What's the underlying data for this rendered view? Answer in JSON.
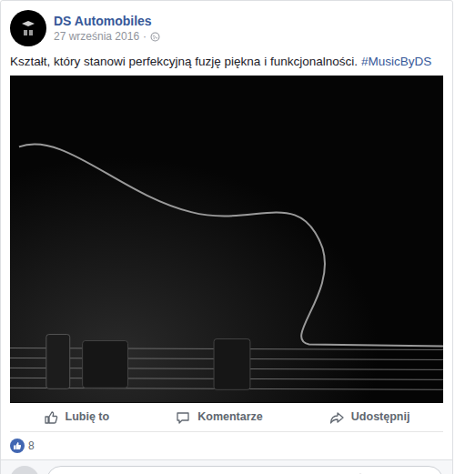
{
  "page": {
    "name": "DS Automobiles",
    "date": "27 września 2016",
    "separator": "·"
  },
  "post": {
    "text": "Kształt, który stanowi perfekcyjną fuzję piękna i funkcjonalności.",
    "hashtag": "#MusicByDS"
  },
  "actions": [
    {
      "label": "Lubię to"
    },
    {
      "label": "Komentarze"
    },
    {
      "label": "Udostępnij"
    }
  ],
  "reactions": {
    "count": "8"
  }
}
